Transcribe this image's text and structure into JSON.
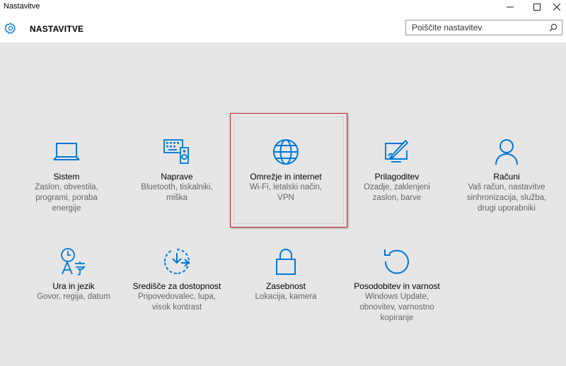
{
  "window": {
    "title": "Nastavitve",
    "minimize_label": "—",
    "maximize_label": "☐",
    "close_label": "✕"
  },
  "header": {
    "app_title": "NASTAVITVE",
    "icon": "gear-icon",
    "search_placeholder": "Poiščite nastavitev",
    "search_icon": "search-icon"
  },
  "colors": {
    "accent": "#0078d7",
    "selection_border": "#c8262a",
    "background": "#e6e6e6"
  },
  "tiles": [
    {
      "label": "Sistem",
      "desc": [
        "Zaslon, obvestila,",
        "programi, poraba",
        "energije"
      ],
      "icon": "laptop-icon"
    },
    {
      "label": "Naprave",
      "desc": [
        "Bluetooth, tiskalniki,",
        "miška"
      ],
      "icon": "devices-icon"
    },
    {
      "label": "Omrežje in internet",
      "desc": [
        "Wi-Fi, letalski način,",
        "VPN"
      ],
      "icon": "globe-icon",
      "selected": true
    },
    {
      "label": "Prilagoditev",
      "desc": [
        "Ozadje, zaklenjeni",
        "zaslon, barve"
      ],
      "icon": "paint-icon"
    },
    {
      "label": "Računi",
      "desc": [
        "Vaš račun, nastavitve",
        "sinhronizacija, služba,",
        "drugi uporabniki"
      ],
      "icon": "person-icon"
    },
    {
      "label": "Ura in jezik",
      "desc": [
        "Govor, regija, datum"
      ],
      "icon": "time-language-icon"
    },
    {
      "label": "Središče za dostopnost",
      "desc": [
        "Pripovedovalec, lupa,",
        "visok kontrast"
      ],
      "icon": "accessibility-icon"
    },
    {
      "label": "Zasebnost",
      "desc": [
        "Lokacija, kamera"
      ],
      "icon": "lock-icon"
    },
    {
      "label": "Posodobitev in varnost",
      "desc": [
        "Windows Update,",
        "obnovitev, varnostno",
        "kopiranje"
      ],
      "icon": "update-icon"
    }
  ]
}
